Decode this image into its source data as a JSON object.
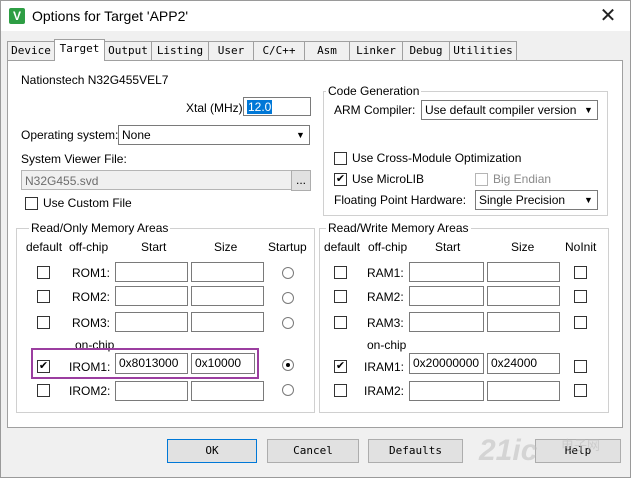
{
  "window": {
    "title": "Options for Target 'APP2'",
    "close_symbol": "✕"
  },
  "tabs": [
    "Device",
    "Target",
    "Output",
    "Listing",
    "User",
    "C/C++",
    "Asm",
    "Linker",
    "Debug",
    "Utilities"
  ],
  "active_tab": "Target",
  "device": "Nationstech N32G455VEL7",
  "xtal": {
    "label": "Xtal (MHz):",
    "value": "12.0"
  },
  "os": {
    "label": "Operating system:",
    "value": "None"
  },
  "svd": {
    "label": "System Viewer File:",
    "value": "N32G455.svd",
    "browse": "..."
  },
  "custom_file": {
    "label": "Use Custom File",
    "checked": false
  },
  "codegen": {
    "title": "Code Generation",
    "compiler_label": "ARM Compiler:",
    "compiler_value": "Use default compiler version",
    "cross_module": {
      "label": "Use Cross-Module Optimization",
      "checked": false
    },
    "microlib": {
      "label": "Use MicroLIB",
      "checked": true
    },
    "big_endian": {
      "label": "Big Endian",
      "checked": false
    },
    "fpu_label": "Floating Point Hardware:",
    "fpu_value": "Single Precision"
  },
  "rom": {
    "title": "Read/Only Memory Areas",
    "headers": {
      "default": "default",
      "offchip": "off-chip",
      "start": "Start",
      "size": "Size",
      "startup": "Startup"
    },
    "onchip_label": "on-chip",
    "rows": [
      {
        "name": "ROM1:",
        "start": "",
        "size": "",
        "default": false,
        "startup": false
      },
      {
        "name": "ROM2:",
        "start": "",
        "size": "",
        "default": false,
        "startup": false
      },
      {
        "name": "ROM3:",
        "start": "",
        "size": "",
        "default": false,
        "startup": false
      },
      {
        "name": "IROM1:",
        "start": "0x8013000",
        "size": "0x10000",
        "default": true,
        "startup": true
      },
      {
        "name": "IROM2:",
        "start": "",
        "size": "",
        "default": false,
        "startup": false
      }
    ]
  },
  "ram": {
    "title": "Read/Write Memory Areas",
    "headers": {
      "default": "default",
      "offchip": "off-chip",
      "start": "Start",
      "size": "Size",
      "noinit": "NoInit"
    },
    "onchip_label": "on-chip",
    "rows": [
      {
        "name": "RAM1:",
        "start": "",
        "size": "",
        "default": false
      },
      {
        "name": "RAM2:",
        "start": "",
        "size": "",
        "default": false
      },
      {
        "name": "RAM3:",
        "start": "",
        "size": "",
        "default": false
      },
      {
        "name": "IRAM1:",
        "start": "0x20000000",
        "size": "0x24000",
        "default": true
      },
      {
        "name": "IRAM2:",
        "start": "",
        "size": "",
        "default": false
      }
    ]
  },
  "buttons": {
    "ok": "OK",
    "cancel": "Cancel",
    "defaults": "Defaults",
    "help": "Help"
  },
  "watermark": {
    "text": "21ic",
    "sub": "电子网"
  },
  "colors": {
    "highlight": "#9b3ea0",
    "selection": "#0078d7",
    "title_icon": "#2e9e44"
  }
}
